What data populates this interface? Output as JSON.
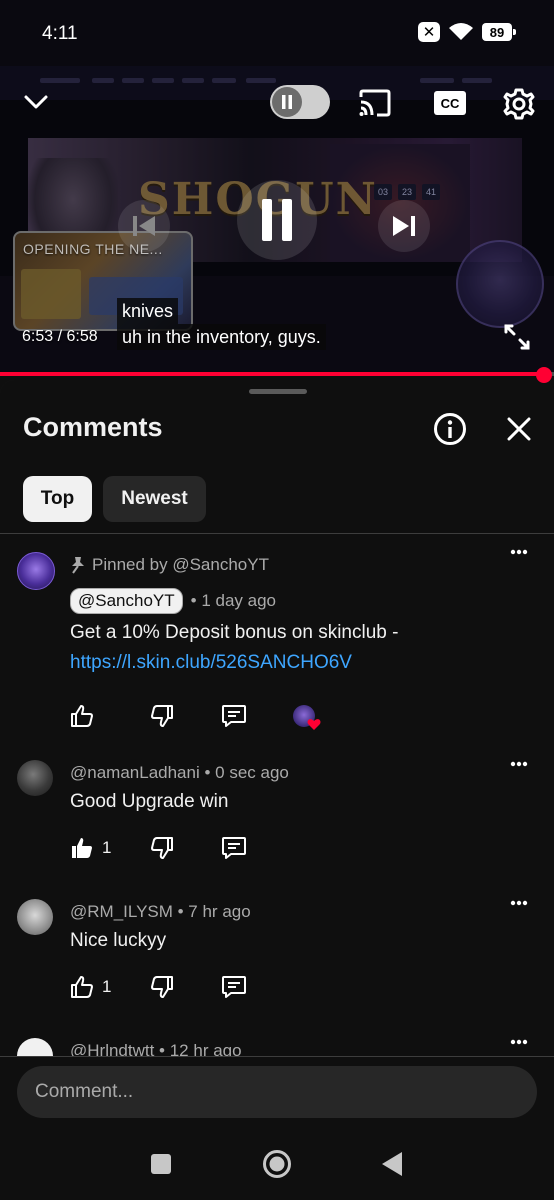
{
  "status_bar": {
    "time": "4:11",
    "battery": "89",
    "icons": [
      "sim-off-icon",
      "wifi-icon",
      "battery-icon"
    ]
  },
  "player": {
    "elapsed": "6:53",
    "duration": "6:58",
    "time_display": "6:53 / 6:58",
    "progress_fraction": 0.988,
    "captions": [
      "knives",
      "uh in the inventory, guys."
    ],
    "cc_label": "CC",
    "preview_title": "OPENING THE NE...",
    "accent_color": "#ff0033",
    "controls": [
      "chevron-down-icon",
      "autoplay-toggle",
      "cast-icon",
      "cc-icon",
      "gear-icon",
      "skip-previous-icon",
      "pause-icon",
      "skip-next-icon",
      "fullscreen-icon"
    ]
  },
  "comments_panel": {
    "title": "Comments",
    "filters": [
      {
        "label": "Top",
        "selected": true
      },
      {
        "label": "Newest",
        "selected": false
      }
    ],
    "input_placeholder": "Comment...",
    "link_color": "#3ea6ff",
    "comments": [
      {
        "pinned_label": "Pinned by @SanchoYT",
        "author": "@SanchoYT",
        "time": "1 day ago",
        "text": "Get a 10% Deposit bonus on skinclub - ",
        "link": "https://l.skin.club/526SANCHO6V",
        "likes": "",
        "creator_heart": true
      },
      {
        "author": "@namanLadhani",
        "time": "0 sec ago",
        "meta": "@namanLadhani • 0 sec ago",
        "text": "Good Upgrade win",
        "likes": "1",
        "liked": true
      },
      {
        "author": "@RM_ILYSM",
        "time": "7 hr ago",
        "meta": "@RM_ILYSM • 7 hr ago",
        "text": "Nice luckyy",
        "likes": "1",
        "liked": false
      },
      {
        "author": "@Hrlndtwtt",
        "time": "12 hr ago",
        "meta": "@Hrlndtwtt • 12 hr ago"
      }
    ]
  },
  "nav_bar": {
    "buttons": [
      "recents-icon",
      "home-icon",
      "back-icon"
    ]
  }
}
